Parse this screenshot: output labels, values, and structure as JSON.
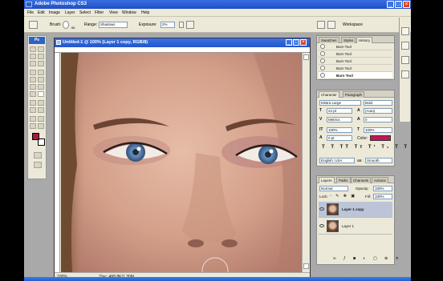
{
  "window": {
    "title": "Adobe Photoshop CS3"
  },
  "menu": [
    "File",
    "Edit",
    "Image",
    "Layer",
    "Select",
    "Filter",
    "View",
    "Window",
    "Help"
  ],
  "options": {
    "brush_label": "Brush:",
    "brush_size": "65",
    "range_label": "Range:",
    "range_value": "Shadows",
    "exposure_label": "Exposure:",
    "exposure_value": "2%",
    "workspace_label": "Workspace"
  },
  "toolbox": {
    "badge": "Ps",
    "foreground_color": "#a8163a",
    "background_color": "#ffffff"
  },
  "document": {
    "title": "Untitled-1 @ 100% (Layer 1 copy, RGB/8)",
    "zoom": "100%",
    "doc_info": "Doc: 468.8K/1.30M"
  },
  "history_panel": {
    "tabs": [
      "Swatches",
      "Styles",
      "History"
    ],
    "active_tab": "History",
    "items": [
      {
        "label": "Burn Tool",
        "selected": false
      },
      {
        "label": "Burn Tool",
        "selected": false
      },
      {
        "label": "Burn Tool",
        "selected": false
      },
      {
        "label": "Burn Tool",
        "selected": false
      },
      {
        "label": "Burn Tool",
        "selected": true
      }
    ]
  },
  "character_panel": {
    "tabs": [
      "Character",
      "Paragraph"
    ],
    "font_family": "Mistra Large",
    "font_style": "Bold",
    "font_size": "24 pt",
    "leading": "(Auto)",
    "kerning": "Metrics",
    "tracking": "0",
    "vertical_scale": "100%",
    "horizontal_scale": "100%",
    "baseline_shift": "0 pt",
    "color_label": "Color:",
    "color_value": "#c4145a",
    "language": "English: USA",
    "antialias_a": "aa",
    "antialias": "Smooth"
  },
  "layers_panel": {
    "tabs": [
      "Layers",
      "Paths",
      "Channels",
      "Actions"
    ],
    "blend_mode": "Normal",
    "opacity_label": "Opacity:",
    "opacity": "100%",
    "lock_label": "Lock:",
    "fill_label": "Fill:",
    "fill": "100%",
    "layers": [
      {
        "name": "Layer 1 copy",
        "selected": true
      },
      {
        "name": "Layer 1",
        "selected": false
      }
    ]
  }
}
